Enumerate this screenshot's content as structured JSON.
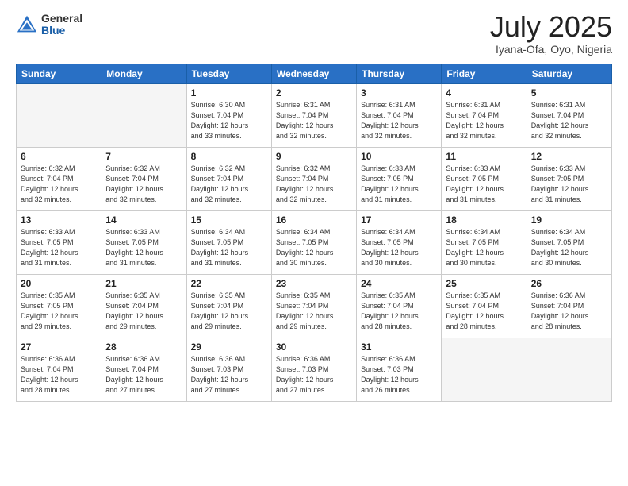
{
  "logo": {
    "general": "General",
    "blue": "Blue"
  },
  "header": {
    "month_year": "July 2025",
    "location": "Iyana-Ofa, Oyo, Nigeria"
  },
  "days_of_week": [
    "Sunday",
    "Monday",
    "Tuesday",
    "Wednesday",
    "Thursday",
    "Friday",
    "Saturday"
  ],
  "weeks": [
    [
      {
        "day": "",
        "info": ""
      },
      {
        "day": "",
        "info": ""
      },
      {
        "day": "1",
        "info": "Sunrise: 6:30 AM\nSunset: 7:04 PM\nDaylight: 12 hours\nand 33 minutes."
      },
      {
        "day": "2",
        "info": "Sunrise: 6:31 AM\nSunset: 7:04 PM\nDaylight: 12 hours\nand 32 minutes."
      },
      {
        "day": "3",
        "info": "Sunrise: 6:31 AM\nSunset: 7:04 PM\nDaylight: 12 hours\nand 32 minutes."
      },
      {
        "day": "4",
        "info": "Sunrise: 6:31 AM\nSunset: 7:04 PM\nDaylight: 12 hours\nand 32 minutes."
      },
      {
        "day": "5",
        "info": "Sunrise: 6:31 AM\nSunset: 7:04 PM\nDaylight: 12 hours\nand 32 minutes."
      }
    ],
    [
      {
        "day": "6",
        "info": "Sunrise: 6:32 AM\nSunset: 7:04 PM\nDaylight: 12 hours\nand 32 minutes."
      },
      {
        "day": "7",
        "info": "Sunrise: 6:32 AM\nSunset: 7:04 PM\nDaylight: 12 hours\nand 32 minutes."
      },
      {
        "day": "8",
        "info": "Sunrise: 6:32 AM\nSunset: 7:04 PM\nDaylight: 12 hours\nand 32 minutes."
      },
      {
        "day": "9",
        "info": "Sunrise: 6:32 AM\nSunset: 7:04 PM\nDaylight: 12 hours\nand 32 minutes."
      },
      {
        "day": "10",
        "info": "Sunrise: 6:33 AM\nSunset: 7:05 PM\nDaylight: 12 hours\nand 31 minutes."
      },
      {
        "day": "11",
        "info": "Sunrise: 6:33 AM\nSunset: 7:05 PM\nDaylight: 12 hours\nand 31 minutes."
      },
      {
        "day": "12",
        "info": "Sunrise: 6:33 AM\nSunset: 7:05 PM\nDaylight: 12 hours\nand 31 minutes."
      }
    ],
    [
      {
        "day": "13",
        "info": "Sunrise: 6:33 AM\nSunset: 7:05 PM\nDaylight: 12 hours\nand 31 minutes."
      },
      {
        "day": "14",
        "info": "Sunrise: 6:33 AM\nSunset: 7:05 PM\nDaylight: 12 hours\nand 31 minutes."
      },
      {
        "day": "15",
        "info": "Sunrise: 6:34 AM\nSunset: 7:05 PM\nDaylight: 12 hours\nand 31 minutes."
      },
      {
        "day": "16",
        "info": "Sunrise: 6:34 AM\nSunset: 7:05 PM\nDaylight: 12 hours\nand 30 minutes."
      },
      {
        "day": "17",
        "info": "Sunrise: 6:34 AM\nSunset: 7:05 PM\nDaylight: 12 hours\nand 30 minutes."
      },
      {
        "day": "18",
        "info": "Sunrise: 6:34 AM\nSunset: 7:05 PM\nDaylight: 12 hours\nand 30 minutes."
      },
      {
        "day": "19",
        "info": "Sunrise: 6:34 AM\nSunset: 7:05 PM\nDaylight: 12 hours\nand 30 minutes."
      }
    ],
    [
      {
        "day": "20",
        "info": "Sunrise: 6:35 AM\nSunset: 7:05 PM\nDaylight: 12 hours\nand 29 minutes."
      },
      {
        "day": "21",
        "info": "Sunrise: 6:35 AM\nSunset: 7:04 PM\nDaylight: 12 hours\nand 29 minutes."
      },
      {
        "day": "22",
        "info": "Sunrise: 6:35 AM\nSunset: 7:04 PM\nDaylight: 12 hours\nand 29 minutes."
      },
      {
        "day": "23",
        "info": "Sunrise: 6:35 AM\nSunset: 7:04 PM\nDaylight: 12 hours\nand 29 minutes."
      },
      {
        "day": "24",
        "info": "Sunrise: 6:35 AM\nSunset: 7:04 PM\nDaylight: 12 hours\nand 28 minutes."
      },
      {
        "day": "25",
        "info": "Sunrise: 6:35 AM\nSunset: 7:04 PM\nDaylight: 12 hours\nand 28 minutes."
      },
      {
        "day": "26",
        "info": "Sunrise: 6:36 AM\nSunset: 7:04 PM\nDaylight: 12 hours\nand 28 minutes."
      }
    ],
    [
      {
        "day": "27",
        "info": "Sunrise: 6:36 AM\nSunset: 7:04 PM\nDaylight: 12 hours\nand 28 minutes."
      },
      {
        "day": "28",
        "info": "Sunrise: 6:36 AM\nSunset: 7:04 PM\nDaylight: 12 hours\nand 27 minutes."
      },
      {
        "day": "29",
        "info": "Sunrise: 6:36 AM\nSunset: 7:03 PM\nDaylight: 12 hours\nand 27 minutes."
      },
      {
        "day": "30",
        "info": "Sunrise: 6:36 AM\nSunset: 7:03 PM\nDaylight: 12 hours\nand 27 minutes."
      },
      {
        "day": "31",
        "info": "Sunrise: 6:36 AM\nSunset: 7:03 PM\nDaylight: 12 hours\nand 26 minutes."
      },
      {
        "day": "",
        "info": ""
      },
      {
        "day": "",
        "info": ""
      }
    ]
  ]
}
